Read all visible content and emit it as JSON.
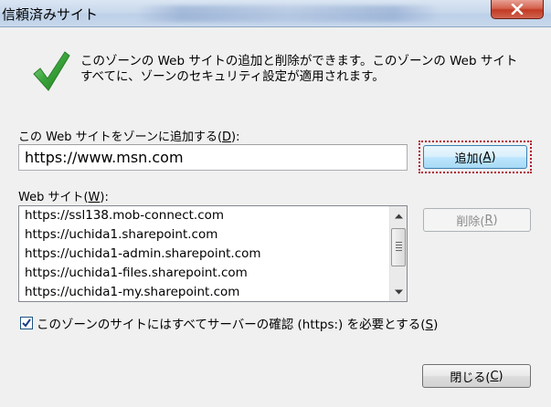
{
  "window": {
    "title": "信頼済みサイト",
    "close_icon": "close-x-icon"
  },
  "info": {
    "icon": "green-checkmark-icon",
    "line1": "このゾーンの Web サイトの追加と削除ができます。このゾーンの Web サイト",
    "line2": "すべてに、ゾーンのセキュリティ設定が適用されます。"
  },
  "add_section": {
    "label_prefix": "この Web サイトをゾーンに追加する(",
    "label_key": "D",
    "label_suffix": "):",
    "input_value": "https://www.msn.com",
    "add_button_prefix": "追加(",
    "add_button_key": "A",
    "add_button_suffix": ")"
  },
  "sites_section": {
    "label_prefix": "Web サイト(",
    "label_key": "W",
    "label_suffix": "):",
    "sites": [
      "https://ssl138.mob-connect.com",
      "https://uchida1.sharepoint.com",
      "https://uchida1-admin.sharepoint.com",
      "https://uchida1-files.sharepoint.com",
      "https://uchida1-my.sharepoint.com"
    ],
    "remove_button_prefix": "削除(",
    "remove_button_key": "R",
    "remove_button_suffix": ")"
  },
  "https_option": {
    "checked": true,
    "label_prefix": "このゾーンのサイトにはすべてサーバーの確認 (https:) を必要とする(",
    "label_key": "S",
    "label_suffix": ")"
  },
  "footer": {
    "close_button_prefix": "閉じる(",
    "close_button_key": "C",
    "close_button_suffix": ")"
  },
  "colors": {
    "titlebar": "#c9d9ec",
    "close_button": "#c23a22",
    "focus_border": "#b0102a",
    "check_green": "#3aa33a"
  }
}
